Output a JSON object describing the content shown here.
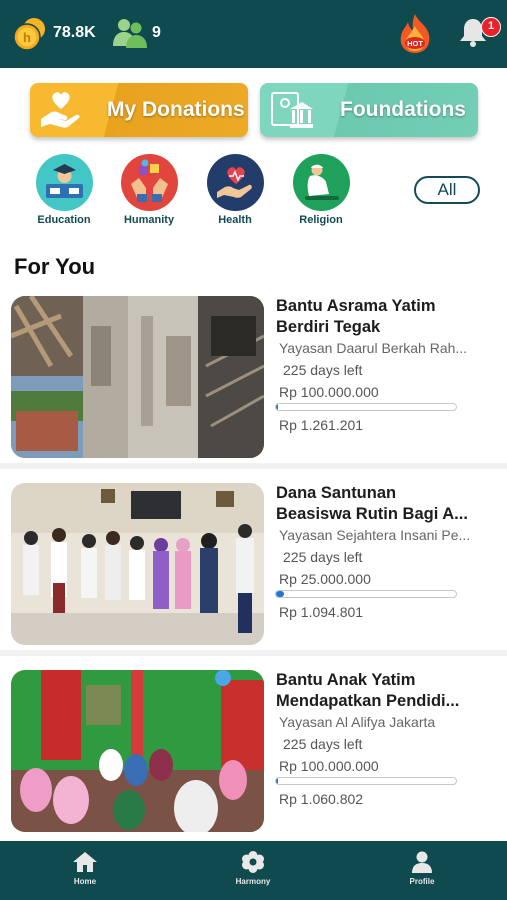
{
  "header": {
    "coins": "78.8K",
    "people": "9",
    "hot_label": "HOT",
    "notification_count": "1"
  },
  "actions": {
    "donations_label": "My Donations",
    "foundations_label": "Foundations"
  },
  "categories": [
    {
      "label": "Education",
      "icon": "graduate-icon"
    },
    {
      "label": "Humanity",
      "icon": "hands-icon"
    },
    {
      "label": "Health",
      "icon": "heart-hand-icon"
    },
    {
      "label": "Religion",
      "icon": "prayer-icon"
    }
  ],
  "all_label": "All",
  "section_title": "For You",
  "campaigns": [
    {
      "title_line1": "Bantu Asrama Yatim",
      "title_line2": "Berdiri Tegak",
      "foundation": "Yayasan Daarul Berkah Rah...",
      "days_left": "225 days left",
      "target": "Rp 100.000.000",
      "collected": "Rp 1.261.201",
      "progress": 0.013
    },
    {
      "title_line1": "Dana Santunan",
      "title_line2": "Beasiswa Rutin Bagi A...",
      "foundation": "Yayasan Sejahtera Insani Pe...",
      "days_left": "225 days left",
      "target": "Rp 25.000.000",
      "collected": "Rp 1.094.801",
      "progress": 0.044
    },
    {
      "title_line1": "Bantu Anak Yatim",
      "title_line2": "Mendapatkan Pendidi...",
      "foundation": "Yayasan Al Alifya Jakarta",
      "days_left": "225 days left",
      "target": "Rp 100.000.000",
      "collected": "Rp 1.060.802",
      "progress": 0.011
    }
  ],
  "nav": [
    {
      "label": "Home",
      "icon": "home-icon"
    },
    {
      "label": "Harmony",
      "icon": "flower-icon"
    },
    {
      "label": "Profile",
      "icon": "person-icon"
    }
  ],
  "colors": {
    "header_bg": "#0f4a4f",
    "donations_btn": "#f6b930",
    "foundations_btn": "#7ed6be",
    "progress_fill": "#1e78d6",
    "badge": "#e8212b"
  }
}
